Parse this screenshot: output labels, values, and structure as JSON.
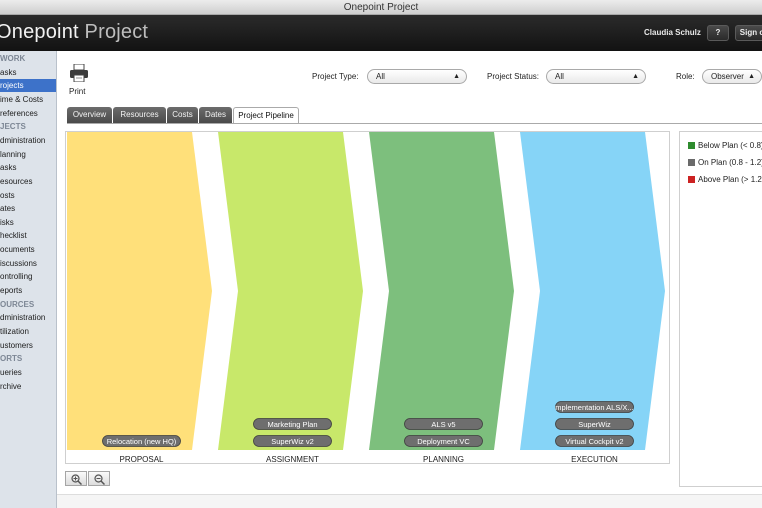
{
  "window": {
    "title": "Onepoint Project"
  },
  "header": {
    "logo_main": "Onepoint",
    "logo_light": "Project",
    "user": "Claudia Schulz",
    "help_label": "?",
    "signout_label": "Sign o"
  },
  "sidebar": {
    "items": [
      {
        "label": "WORK",
        "kind": "head"
      },
      {
        "label": "asks",
        "kind": "link"
      },
      {
        "label": "rojects",
        "kind": "active"
      },
      {
        "label": "ime & Costs",
        "kind": "link"
      },
      {
        "label": "references",
        "kind": "link"
      },
      {
        "label": "JECTS",
        "kind": "head"
      },
      {
        "label": "dministration",
        "kind": "link"
      },
      {
        "label": "lanning",
        "kind": "link"
      },
      {
        "label": "asks",
        "kind": "link"
      },
      {
        "label": "esources",
        "kind": "link"
      },
      {
        "label": "osts",
        "kind": "link"
      },
      {
        "label": "ates",
        "kind": "link"
      },
      {
        "label": "isks",
        "kind": "link"
      },
      {
        "label": "hecklist",
        "kind": "link"
      },
      {
        "label": "ocuments",
        "kind": "link"
      },
      {
        "label": "iscussions",
        "kind": "link"
      },
      {
        "label": "ontrolling",
        "kind": "link"
      },
      {
        "label": "eports",
        "kind": "link"
      },
      {
        "label": "OURCES",
        "kind": "head"
      },
      {
        "label": "dministration",
        "kind": "link"
      },
      {
        "label": "tilization",
        "kind": "link"
      },
      {
        "label": "ustomers",
        "kind": "link"
      },
      {
        "label": "ORTS",
        "kind": "head"
      },
      {
        "label": "ueries",
        "kind": "link"
      },
      {
        "label": "rchive",
        "kind": "link"
      }
    ]
  },
  "toolbar": {
    "print_label": "Print"
  },
  "filters": {
    "type_label": "Project Type:",
    "type_value": "All",
    "status_label": "Project Status:",
    "status_value": "All",
    "role_label": "Role:",
    "role_value": "Observer"
  },
  "tabs": [
    "Overview",
    "Resources",
    "Costs",
    "Dates",
    "Project Pipeline"
  ],
  "active_tab": "Project Pipeline",
  "pipeline": {
    "stages": [
      {
        "name": "PROPOSAL",
        "color": "#ffe07a",
        "projects": [
          "Relocation (new HQ)"
        ]
      },
      {
        "name": "ASSIGNMENT",
        "color": "#c8e86a",
        "projects": [
          "Marketing Plan",
          "SuperWiz v2"
        ]
      },
      {
        "name": "PLANNING",
        "color": "#7dbf7d",
        "projects": [
          "ALS v5",
          "Deployment VC"
        ]
      },
      {
        "name": "EXECUTION",
        "color": "#86d4f7",
        "projects": [
          "mplementation ALS/X...",
          "SuperWiz",
          "Virtual Cockpit v2"
        ]
      }
    ]
  },
  "legend": [
    {
      "label": "Below Plan (< 0.8)",
      "color": "#2e8b2e"
    },
    {
      "label": "On Plan (0.8 - 1.2)",
      "color": "#6a6a6a"
    },
    {
      "label": "Above Plan (> 1.2)",
      "color": "#cc2222"
    }
  ]
}
